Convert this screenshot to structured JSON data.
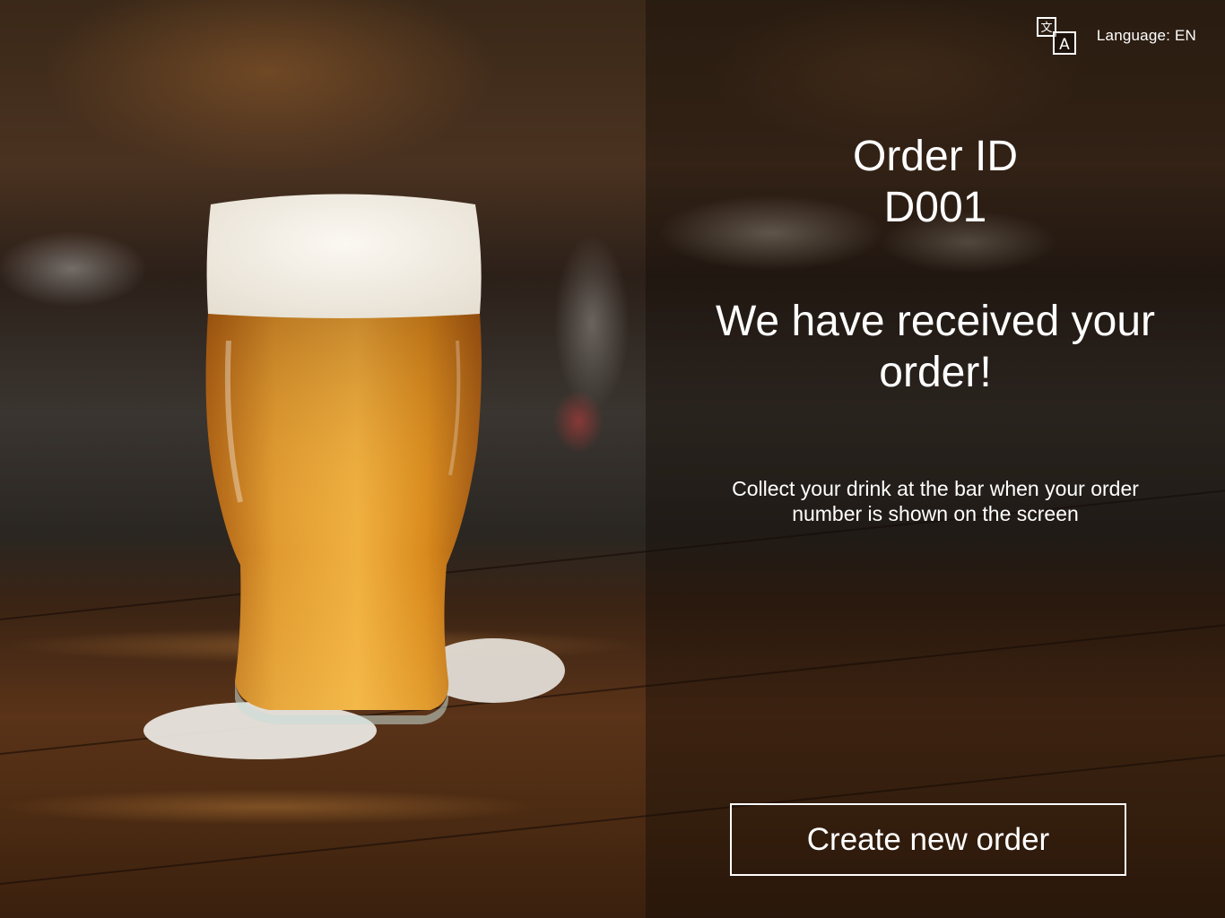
{
  "header": {
    "language_icon": "translate-icon",
    "language_label": "Language: EN"
  },
  "order": {
    "label": "Order ID",
    "id": "D001"
  },
  "messages": {
    "received": "We have received your order!",
    "instructions": "Collect your drink at the bar when your order number is shown on the screen"
  },
  "actions": {
    "create_new_order": "Create new order"
  },
  "background": {
    "image_subject": "beer-glass-on-bar-counter"
  },
  "colors": {
    "text": "#ffffff",
    "panel_overlay": "rgba(18,12,8,0.42)",
    "beer": "#d98a1c",
    "foam": "#f4f1ea"
  }
}
